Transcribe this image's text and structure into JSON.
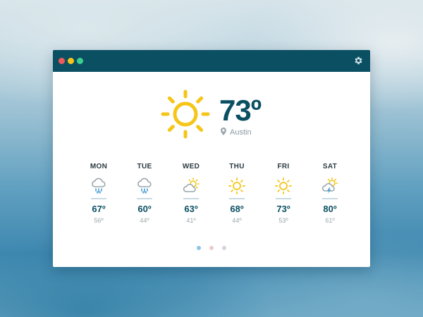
{
  "colors": {
    "titlebar": "#0b4f63",
    "accent": "#0b4f63",
    "sun": "#f5c518",
    "cloud": "#9aa7ad",
    "rain": "#4a9fd8",
    "close": "#f05a5a",
    "minimize": "#f5c518",
    "maximize": "#3ccf8e"
  },
  "window": {
    "controls": [
      "close",
      "minimize",
      "maximize"
    ],
    "settings_icon": "gear-icon"
  },
  "current": {
    "icon": "sun-icon",
    "temperature": "73º",
    "location_icon": "map-pin-icon",
    "location": "Austin"
  },
  "forecast": [
    {
      "day": "MON",
      "icon": "rain-icon",
      "high": "67º",
      "low": "56º"
    },
    {
      "day": "TUE",
      "icon": "rain-icon",
      "high": "60º",
      "low": "44º"
    },
    {
      "day": "WED",
      "icon": "partly-cloudy-icon",
      "high": "63º",
      "low": "41º"
    },
    {
      "day": "THU",
      "icon": "sun-icon",
      "high": "68º",
      "low": "44º"
    },
    {
      "day": "FRI",
      "icon": "sun-icon",
      "high": "73º",
      "low": "53º"
    },
    {
      "day": "SAT",
      "icon": "thunderstorm-icon",
      "high": "80º",
      "low": "61º"
    }
  ],
  "pager": {
    "pages": 3,
    "active": 1,
    "colors": [
      "#8ec5e6",
      "#f0c8cf",
      "#ddd0e0"
    ]
  }
}
